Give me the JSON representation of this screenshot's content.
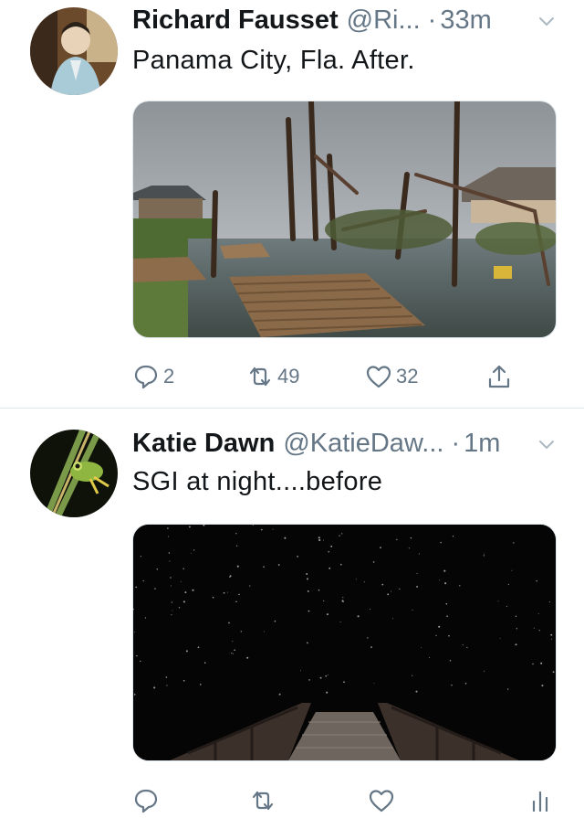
{
  "tweets": [
    {
      "author_name": "Richard Fausset",
      "handle": "@Ri...",
      "separator": "·",
      "time": "33m",
      "text": "Panama City, Fla. After.",
      "replies": "2",
      "retweets": "49",
      "likes": "32"
    },
    {
      "author_name": "Katie Dawn",
      "handle": "@KatieDaw...",
      "separator": "·",
      "time": "1m",
      "text": "SGI at night....before"
    }
  ],
  "icons": {
    "reply": "reply-icon",
    "retweet": "retweet-icon",
    "like": "heart-icon",
    "share": "share-icon",
    "analytics": "analytics-icon",
    "caret": "chevron-down-icon"
  },
  "colors": {
    "text": "#14171a",
    "secondary": "#657786",
    "divider": "#e1e8ed"
  }
}
